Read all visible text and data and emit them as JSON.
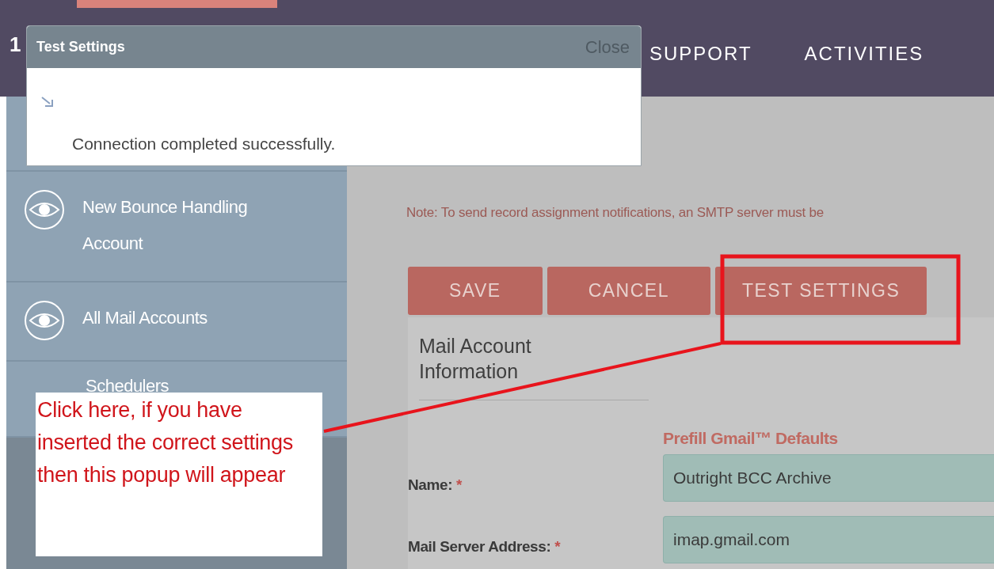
{
  "header": {
    "partial_item": "1",
    "nav_items": [
      "SUPPORT",
      "ACTIVITIES"
    ]
  },
  "sidebar": {
    "items": [
      {
        "label": "New Bounce Handling Account",
        "kind": "eye"
      },
      {
        "label": "All Mail Accounts",
        "kind": "eye"
      },
      {
        "label": "Schedulers",
        "kind": "plain"
      }
    ]
  },
  "note": "Note: To send record assignment notifications, an SMTP server must be",
  "buttons": [
    {
      "label": "SAVE"
    },
    {
      "label": "CANCEL"
    },
    {
      "label": "TEST SETTINGS"
    }
  ],
  "panel": {
    "title": "Mail Account Information",
    "prefill_link": "Prefill Gmail™ Defaults",
    "fields": [
      {
        "label": "Name:",
        "required_mark": "*",
        "value": "Outright BCC Archive"
      },
      {
        "label": "Mail Server Address:",
        "required_mark": "*",
        "value": "imap.gmail.com"
      }
    ]
  },
  "dialog": {
    "title": "Test Settings",
    "close": "Close",
    "message": "Connection completed successfully."
  },
  "annotation": {
    "text": "Click here, if you have inserted the correct settings then this popup will appear"
  }
}
